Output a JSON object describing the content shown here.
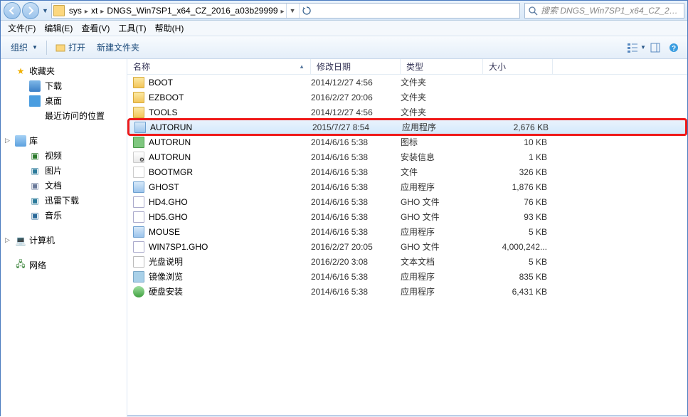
{
  "breadcrumbs": [
    "sys",
    "xt",
    "DNGS_Win7SP1_x64_CZ_2016_a03b29999"
  ],
  "search_placeholder": "搜索 DNGS_Win7SP1_x64_CZ_2016...",
  "menu": {
    "file": "文件(F)",
    "edit": "编辑(E)",
    "view": "查看(V)",
    "tools": "工具(T)",
    "help": "帮助(H)"
  },
  "toolbar": {
    "organize": "组织",
    "open": "打开",
    "newfolder": "新建文件夹"
  },
  "sidebar": {
    "favorites": {
      "label": "收藏夹",
      "items": [
        {
          "label": "下载",
          "ico": "dl-ico"
        },
        {
          "label": "桌面",
          "ico": "desk-ico"
        },
        {
          "label": "最近访问的位置",
          "ico": "recent-ico"
        }
      ]
    },
    "libraries": {
      "label": "库",
      "items": [
        {
          "label": "视频",
          "ico": "vid-ico"
        },
        {
          "label": "图片",
          "ico": "pic-ico"
        },
        {
          "label": "文档",
          "ico": "doc-ico"
        },
        {
          "label": "迅雷下载",
          "ico": "xl-ico"
        },
        {
          "label": "音乐",
          "ico": "mus-ico"
        }
      ]
    },
    "computer": {
      "label": "计算机"
    },
    "network": {
      "label": "网络"
    }
  },
  "columns": {
    "name": "名称",
    "date": "修改日期",
    "type": "类型",
    "size": "大小"
  },
  "files": [
    {
      "name": "BOOT",
      "date": "2014/12/27 4:56",
      "type": "文件夹",
      "size": "",
      "ico": "ico-folder"
    },
    {
      "name": "EZBOOT",
      "date": "2016/2/27 20:06",
      "type": "文件夹",
      "size": "",
      "ico": "ico-folder"
    },
    {
      "name": "TOOLS",
      "date": "2014/12/27 4:56",
      "type": "文件夹",
      "size": "",
      "ico": "ico-folder"
    },
    {
      "name": "AUTORUN",
      "date": "2015/7/27 8:54",
      "type": "应用程序",
      "size": "2,676 KB",
      "ico": "ico-app",
      "selected": true,
      "highlighted": true
    },
    {
      "name": "AUTORUN",
      "date": "2014/6/16 5:38",
      "type": "图标",
      "size": "10 KB",
      "ico": "ico-icon"
    },
    {
      "name": "AUTORUN",
      "date": "2014/6/16 5:38",
      "type": "安装信息",
      "size": "1 KB",
      "ico": "ico-inf"
    },
    {
      "name": "BOOTMGR",
      "date": "2014/6/16 5:38",
      "type": "文件",
      "size": "326 KB",
      "ico": "ico-file"
    },
    {
      "name": "GHOST",
      "date": "2014/6/16 5:38",
      "type": "应用程序",
      "size": "1,876 KB",
      "ico": "ico-app"
    },
    {
      "name": "HD4.GHO",
      "date": "2014/6/16 5:38",
      "type": "GHO 文件",
      "size": "76 KB",
      "ico": "ico-gho"
    },
    {
      "name": "HD5.GHO",
      "date": "2014/6/16 5:38",
      "type": "GHO 文件",
      "size": "93 KB",
      "ico": "ico-gho"
    },
    {
      "name": "MOUSE",
      "date": "2014/6/16 5:38",
      "type": "应用程序",
      "size": "5 KB",
      "ico": "ico-app"
    },
    {
      "name": "WIN7SP1.GHO",
      "date": "2016/2/27 20:05",
      "type": "GHO 文件",
      "size": "4,000,242...",
      "ico": "ico-gho"
    },
    {
      "name": "光盘说明",
      "date": "2016/2/20 3:08",
      "type": "文本文档",
      "size": "5 KB",
      "ico": "ico-txt"
    },
    {
      "name": "镜像浏览",
      "date": "2014/6/16 5:38",
      "type": "应用程序",
      "size": "835 KB",
      "ico": "ico-img"
    },
    {
      "name": "硬盘安装",
      "date": "2014/6/16 5:38",
      "type": "应用程序",
      "size": "6,431 KB",
      "ico": "ico-disk"
    }
  ]
}
